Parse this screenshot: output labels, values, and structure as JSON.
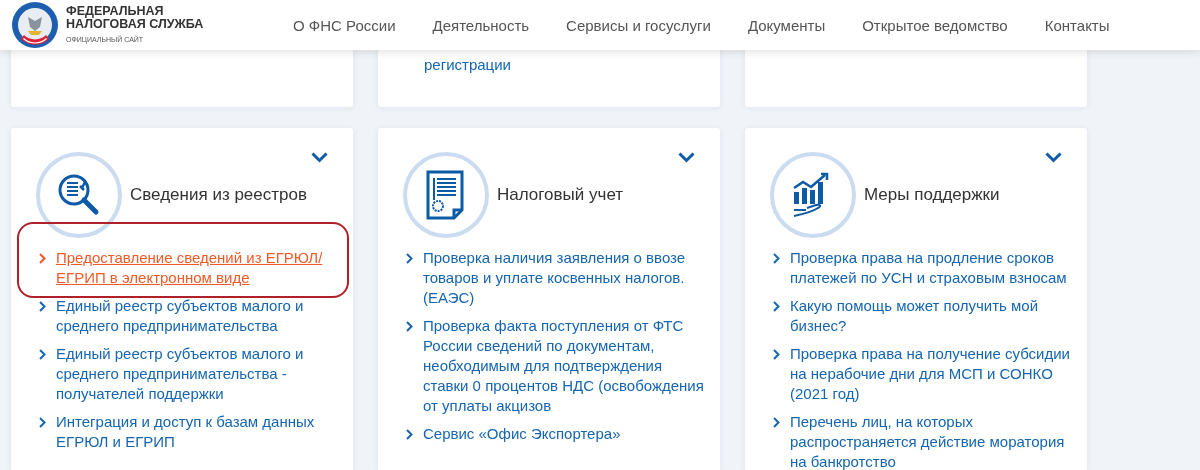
{
  "header": {
    "logo": {
      "line_1": "ФЕДЕРАЛЬНАЯ",
      "line_2": "НАЛОГОВАЯ СЛУЖБА",
      "subtitle": "ОФИЦИАЛЬНЫЙ САЙТ"
    },
    "nav": [
      "О ФНС России",
      "Деятельность",
      "Сервисы и госуслуги",
      "Документы",
      "Открытое ведомство",
      "Контакты"
    ]
  },
  "partial_card": {
    "links": [
      "регистрации"
    ]
  },
  "service_cards": [
    {
      "kind": "registry",
      "title": "Сведения из реестров",
      "links": [
        {
          "text": "Предоставление сведений из ЕГРЮЛ/ ЕГРИП в электронном виде",
          "highlighted": true
        },
        {
          "text": "Единый реестр субъектов малого и среднего предпринимательства",
          "highlighted": false
        },
        {
          "text": "Единый реестр субъектов малого и среднего предпринимательства - получателей поддержки",
          "highlighted": false
        },
        {
          "text": "Интеграция и доступ к базам данных ЕГРЮЛ и ЕГРИП",
          "highlighted": false
        }
      ]
    },
    {
      "kind": "document",
      "title": "Налоговый учет",
      "links": [
        {
          "text": "Проверка наличия заявления о ввозе товаров и уплате косвенных налогов. (ЕАЭС)",
          "highlighted": false
        },
        {
          "text": "Проверка факта поступления от ФТС России сведений по документам, необходимым для подтверждения ставки 0 процентов НДС (освобождения от уплаты акцизов",
          "highlighted": false
        },
        {
          "text": "Сервис «Офис Экспортера»",
          "highlighted": false
        }
      ]
    },
    {
      "kind": "support",
      "title": "Меры поддержки",
      "links": [
        {
          "text": "Проверка права на продление сроков платежей по УСН и страховым взносам",
          "highlighted": false
        },
        {
          "text": "Какую помощь может получить мой бизнес?",
          "highlighted": false
        },
        {
          "text": "Проверка права на получение субсидии на нерабочие дни для МСП и СОНКО (2021 год)",
          "highlighted": false
        },
        {
          "text": "Перечень лиц, на которых распространяется действие моратория на банкротство",
          "highlighted": false
        }
      ]
    }
  ]
}
